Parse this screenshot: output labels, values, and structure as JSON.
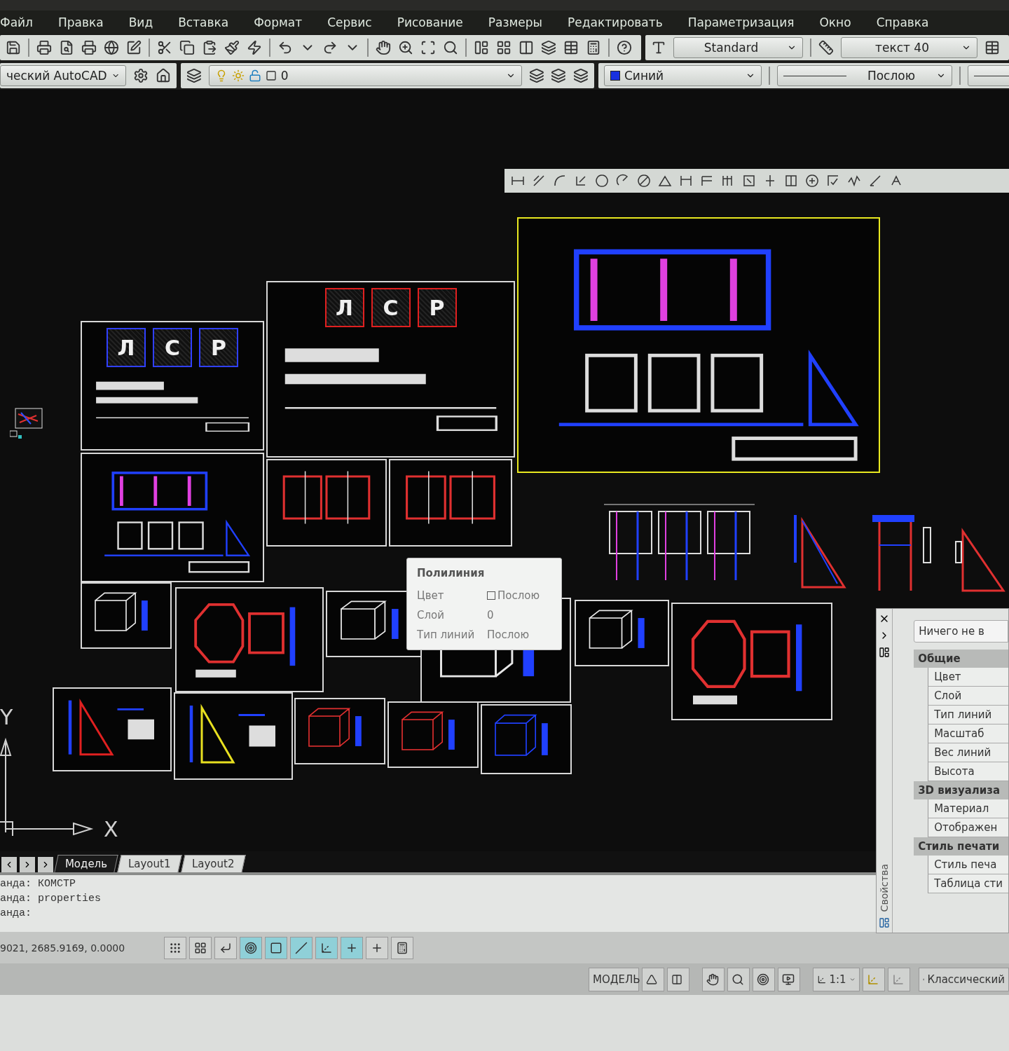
{
  "menu": [
    "Файл",
    "Правка",
    "Вид",
    "Вставка",
    "Формат",
    "Сервис",
    "Рисование",
    "Размеры",
    "Редактировать",
    "Параметризация",
    "Окно",
    "Справка"
  ],
  "styles_toolbar": {
    "text_style": "Standard",
    "dim_style": "текст 40"
  },
  "layers_toolbar": {
    "workspace": "ческий AutoCAD",
    "layer": "0",
    "color_name": "Синий",
    "linetype": "Послою"
  },
  "drawing": {
    "sheets": [
      {
        "kind": "letters",
        "letters": [
          "Л",
          "С",
          "Р"
        ],
        "selected": false
      },
      {
        "kind": "letters",
        "letters": [
          "Л",
          "С",
          "Р"
        ],
        "selected": false
      },
      {
        "kind": "facade",
        "selected": true
      },
      {
        "kind": "facade",
        "selected": false
      },
      {
        "kind": "frames",
        "selected": false
      },
      {
        "kind": "frames",
        "selected": false
      },
      {
        "kind": "cube",
        "selected": false
      },
      {
        "kind": "octagon",
        "selected": false
      },
      {
        "kind": "cube",
        "selected": false
      },
      {
        "kind": "cube",
        "selected": false
      },
      {
        "kind": "cube",
        "selected": false
      },
      {
        "kind": "octagon",
        "selected": false
      },
      {
        "kind": "triangle",
        "selected": false
      },
      {
        "kind": "triangle",
        "selected": false
      },
      {
        "kind": "cube",
        "selected": false
      },
      {
        "kind": "cube",
        "selected": false
      },
      {
        "kind": "cube",
        "selected": false
      }
    ],
    "axes": {
      "y": "Y",
      "x": "X"
    }
  },
  "tooltip": {
    "title": "Полилиния",
    "rows": [
      {
        "label": "Цвет",
        "value": "Послою",
        "swatch": true
      },
      {
        "label": "Слой",
        "value": "0",
        "swatch": false
      },
      {
        "label": "Тип линий",
        "value": "Послою",
        "swatch": false
      }
    ]
  },
  "properties": {
    "title": "Свойства",
    "selection": "Ничего не в",
    "groups": [
      {
        "name": "Общие",
        "rows": [
          "Цвет",
          "Слой",
          "Тип линий",
          "Масштаб",
          "Вес линий",
          "Высота"
        ]
      },
      {
        "name": "3D визуализа",
        "rows": [
          "Материал",
          "Отображен"
        ]
      },
      {
        "name": "Стиль печати",
        "rows": [
          "Стиль печа",
          "Таблица сти"
        ]
      }
    ]
  },
  "tabs": [
    {
      "label": "Модель",
      "selected": true
    },
    {
      "label": "Layout1",
      "selected": false
    },
    {
      "label": "Layout2",
      "selected": false
    }
  ],
  "command_lines": [
    "анда: КОМСТР",
    "анда: properties",
    "анда:"
  ],
  "status": {
    "coordinates": "9021, 2685.9169, 0.0000",
    "toggles": [
      {
        "on": false
      },
      {
        "on": false
      },
      {
        "on": false
      },
      {
        "on": true
      },
      {
        "on": true
      },
      {
        "on": true
      },
      {
        "on": true
      },
      {
        "on": true
      },
      {
        "on": false
      },
      {
        "on": false
      }
    ]
  },
  "model_bar": {
    "space": "МОДЕЛЬ",
    "scale": "1:1",
    "workspace": "Классический"
  }
}
